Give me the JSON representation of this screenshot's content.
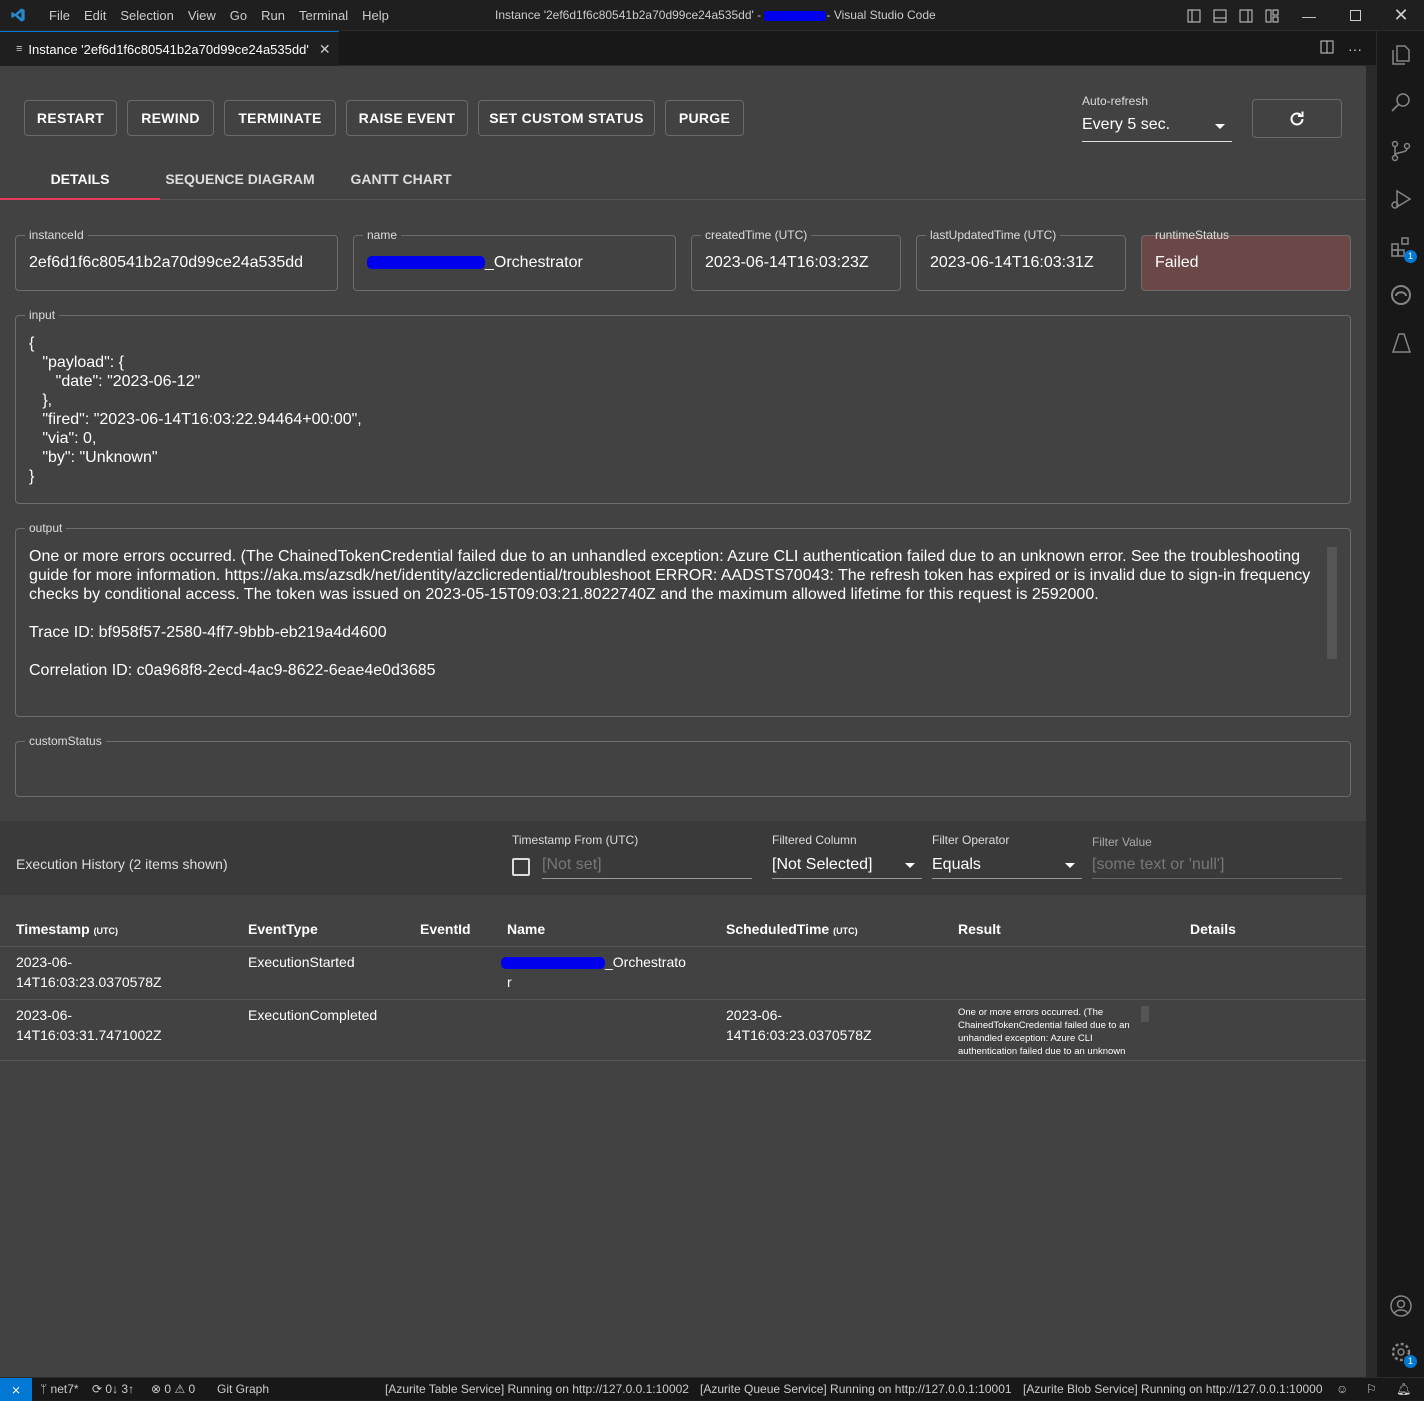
{
  "window": {
    "menu": [
      "File",
      "Edit",
      "Selection",
      "View",
      "Go",
      "Run",
      "Terminal",
      "Help"
    ],
    "title_prefix": "Instance '2ef6d1f6c80541b2a70d99ce24a535dd' - ",
    "title_suffix": "- Visual Studio Code"
  },
  "editor_tab": {
    "label": "Instance '2ef6d1f6c80541b2a70d99ce24a535dd'"
  },
  "toolbar": {
    "restart": "RESTART",
    "rewind": "REWIND",
    "terminate": "TERMINATE",
    "raise_event": "RAISE EVENT",
    "set_custom_status": "SET CUSTOM STATUS",
    "purge": "PURGE",
    "auto_refresh_label": "Auto-refresh",
    "auto_refresh_value": "Every 5 sec."
  },
  "view_tabs": {
    "details": "DETAILS",
    "sequence": "SEQUENCE DIAGRAM",
    "gantt": "GANTT CHART"
  },
  "details": {
    "instanceId": {
      "label": "instanceId",
      "value": "2ef6d1f6c80541b2a70d99ce24a535dd"
    },
    "name": {
      "label": "name",
      "value": "_Orchestrator"
    },
    "createdTime": {
      "label": "createdTime (UTC)",
      "value": "2023-06-14T16:03:23Z"
    },
    "lastUpdatedTime": {
      "label": "lastUpdatedTime (UTC)",
      "value": "2023-06-14T16:03:31Z"
    },
    "runtimeStatus": {
      "label": "runtimeStatus",
      "value": "Failed",
      "color": "#6b4747"
    },
    "input": {
      "label": "input",
      "value": "{\n   \"payload\": {\n      \"date\": \"2023-06-12\"\n   },\n   \"fired\": \"2023-06-14T16:03:22.94464+00:00\",\n   \"via\": 0,\n   \"by\": \"Unknown\"\n}"
    },
    "output": {
      "label": "output",
      "message": "One or more errors occurred. (The ChainedTokenCredential failed due to an unhandled exception: Azure CLI authentication failed due to an unknown error. See the troubleshooting guide for more information. https://aka.ms/azsdk/net/identity/azclicredential/troubleshoot ERROR: AADSTS70043: The refresh token has expired or is invalid due to sign-in frequency checks by conditional access. The token was issued on 2023-05-15T09:03:21.8022740Z and the maximum allowed lifetime for this request is 2592000.",
      "trace": "Trace ID: bf958f57-2580-4ff7-9bbb-eb219a4d4600",
      "correlation": "Correlation ID: c0a968f8-2ecd-4ac9-8622-6eae4e0d3685"
    },
    "customStatus": {
      "label": "customStatus",
      "value": ""
    }
  },
  "history": {
    "title": "Execution History (2 items shown)",
    "timestamp_from_label": "Timestamp From (UTC)",
    "timestamp_from_placeholder": "[Not set]",
    "filtered_column_label": "Filtered Column",
    "filtered_column_value": "[Not Selected]",
    "filter_operator_label": "Filter Operator",
    "filter_operator_value": "Equals",
    "filter_value_label": "Filter Value",
    "filter_value_placeholder": "[some text or 'null']",
    "columns": {
      "timestamp": "Timestamp",
      "utc": "(UTC)",
      "eventType": "EventType",
      "eventId": "EventId",
      "name": "Name",
      "scheduledTime": "ScheduledTime",
      "result": "Result",
      "details": "Details"
    },
    "rows": [
      {
        "timestamp_1": "2023-06-",
        "timestamp_2": "14T16:03:23.0370578Z",
        "eventType": "ExecutionStarted",
        "name_1": "_Orchestrato",
        "name_2": "r",
        "scheduled_1": "",
        "scheduled_2": "",
        "result": ""
      },
      {
        "timestamp_1": "2023-06-",
        "timestamp_2": "14T16:03:31.7471002Z",
        "eventType": "ExecutionCompleted",
        "name_1": "",
        "name_2": "",
        "scheduled_1": "2023-06-",
        "scheduled_2": "14T16:03:23.0370578Z",
        "result": "One or more errors occurred. (The ChainedTokenCredential failed due to an unhandled exception: Azure CLI authentication failed due to an unknown error. Se"
      }
    ]
  },
  "statusbar": {
    "branch": "net7*",
    "sync": "0↓ 3↑",
    "errors": "0",
    "warnings": "0",
    "git_graph": "Git Graph",
    "table_service": "[Azurite Table Service] Running on http://127.0.0.1:10002",
    "queue_service": "[Azurite Queue Service] Running on http://127.0.0.1:10001",
    "blob_service": "[Azurite Blob Service] Running on http://127.0.0.1:10000"
  },
  "activity_bar": {
    "icons": [
      "explorer-icon",
      "search-icon",
      "source-control-icon",
      "run-debug-icon",
      "extensions-icon",
      "edge-icon",
      "azure-icon",
      "account-icon",
      "manage-icon"
    ],
    "extensions_badge": "1",
    "manage_badge": "1"
  },
  "colors": {
    "accent": "#0078d4",
    "tab_underline": "#e43b5c",
    "redaction": "#0000ee"
  }
}
